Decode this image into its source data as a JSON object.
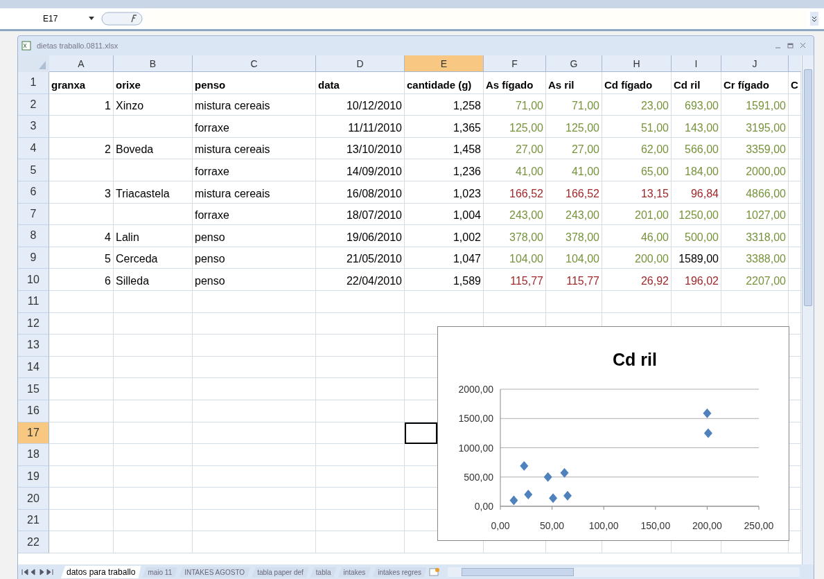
{
  "name_box": "E17",
  "workbook": {
    "title": "dietas traballo.0811.xlsx"
  },
  "columns": [
    {
      "letter": "A",
      "selected": false
    },
    {
      "letter": "B",
      "selected": false
    },
    {
      "letter": "C",
      "selected": false
    },
    {
      "letter": "D",
      "selected": false
    },
    {
      "letter": "E",
      "selected": true
    },
    {
      "letter": "F",
      "selected": false
    },
    {
      "letter": "G",
      "selected": false
    },
    {
      "letter": "H",
      "selected": false
    },
    {
      "letter": "I",
      "selected": false
    },
    {
      "letter": "J",
      "selected": false
    }
  ],
  "rows": [
    {
      "num": "1",
      "selected": false,
      "kind": "header",
      "cells": [
        {
          "text": "granxa"
        },
        {
          "text": "orixe"
        },
        {
          "text": "penso"
        },
        {
          "text": "data"
        },
        {
          "text": "cantidade (g)"
        },
        {
          "text": "As fígado"
        },
        {
          "text": "As ril"
        },
        {
          "text": "Cd fígado"
        },
        {
          "text": "Cd ril"
        },
        {
          "text": "Cr fígado"
        },
        {
          "text": "C"
        }
      ]
    },
    {
      "num": "2",
      "selected": false,
      "kind": "data",
      "cells": [
        {
          "text": "1"
        },
        {
          "text": "Xinzo"
        },
        {
          "text": "mistura cereais"
        },
        {
          "text": "10/12/2010"
        },
        {
          "text": "1,258"
        },
        {
          "text": "71,00",
          "color": "#77933c"
        },
        {
          "text": "71,00",
          "color": "#77933c"
        },
        {
          "text": "23,00",
          "color": "#77933c"
        },
        {
          "text": "693,00",
          "color": "#77933c"
        },
        {
          "text": "1591,00",
          "color": "#77933c"
        },
        null
      ]
    },
    {
      "num": "3",
      "selected": false,
      "kind": "data",
      "cells": [
        null,
        null,
        {
          "text": "forraxe"
        },
        {
          "text": "11/11/2010"
        },
        {
          "text": "1,365"
        },
        {
          "text": "125,00",
          "color": "#77933c"
        },
        {
          "text": "125,00",
          "color": "#77933c"
        },
        {
          "text": "51,00",
          "color": "#77933c"
        },
        {
          "text": "143,00",
          "color": "#77933c"
        },
        {
          "text": "3195,00",
          "color": "#77933c"
        },
        null
      ]
    },
    {
      "num": "4",
      "selected": false,
      "kind": "data",
      "cells": [
        {
          "text": "2"
        },
        {
          "text": "Boveda"
        },
        {
          "text": "mistura cereais"
        },
        {
          "text": "13/10/2010"
        },
        {
          "text": "1,458"
        },
        {
          "text": "27,00",
          "color": "#77933c"
        },
        {
          "text": "27,00",
          "color": "#77933c"
        },
        {
          "text": "62,00",
          "color": "#77933c"
        },
        {
          "text": "566,00",
          "color": "#77933c"
        },
        {
          "text": "3359,00",
          "color": "#77933c"
        },
        null
      ]
    },
    {
      "num": "5",
      "selected": false,
      "kind": "data",
      "cells": [
        null,
        null,
        {
          "text": "forraxe"
        },
        {
          "text": "14/09/2010"
        },
        {
          "text": "1,236"
        },
        {
          "text": "41,00",
          "color": "#77933c"
        },
        {
          "text": "41,00",
          "color": "#77933c"
        },
        {
          "text": "65,00",
          "color": "#77933c"
        },
        {
          "text": "184,00",
          "color": "#77933c"
        },
        {
          "text": "2000,00",
          "color": "#77933c"
        },
        null
      ]
    },
    {
      "num": "6",
      "selected": false,
      "kind": "data",
      "cells": [
        {
          "text": "3"
        },
        {
          "text": "Triacastela"
        },
        {
          "text": "mistura cereais"
        },
        {
          "text": "16/08/2010"
        },
        {
          "text": "1,023"
        },
        {
          "text": "166,52",
          "color": "#a0282a"
        },
        {
          "text": "166,52",
          "color": "#a0282a"
        },
        {
          "text": "13,15",
          "color": "#a0282a"
        },
        {
          "text": "96,84",
          "color": "#a0282a"
        },
        {
          "text": "4866,00",
          "color": "#77933c"
        },
        null
      ]
    },
    {
      "num": "7",
      "selected": false,
      "kind": "data",
      "cells": [
        null,
        null,
        {
          "text": "forraxe"
        },
        {
          "text": "18/07/2010"
        },
        {
          "text": "1,004"
        },
        {
          "text": "243,00",
          "color": "#77933c"
        },
        {
          "text": "243,00",
          "color": "#77933c"
        },
        {
          "text": "201,00",
          "color": "#77933c"
        },
        {
          "text": "1250,00",
          "color": "#77933c"
        },
        {
          "text": "1027,00",
          "color": "#77933c"
        },
        null
      ]
    },
    {
      "num": "8",
      "selected": false,
      "kind": "data",
      "cells": [
        {
          "text": "4"
        },
        {
          "text": "Lalin"
        },
        {
          "text": "penso"
        },
        {
          "text": "19/06/2010"
        },
        {
          "text": "1,002"
        },
        {
          "text": "378,00",
          "color": "#77933c"
        },
        {
          "text": "378,00",
          "color": "#77933c"
        },
        {
          "text": "46,00",
          "color": "#77933c"
        },
        {
          "text": "500,00",
          "color": "#77933c"
        },
        {
          "text": "3318,00",
          "color": "#77933c"
        },
        null
      ]
    },
    {
      "num": "9",
      "selected": false,
      "kind": "data",
      "cells": [
        {
          "text": "5"
        },
        {
          "text": "Cerceda"
        },
        {
          "text": "penso"
        },
        {
          "text": "21/05/2010"
        },
        {
          "text": "1,047"
        },
        {
          "text": "104,00",
          "color": "#77933c"
        },
        {
          "text": "104,00",
          "color": "#77933c"
        },
        {
          "text": "200,00",
          "color": "#77933c"
        },
        {
          "text": "1589,00",
          "color": "#000000"
        },
        {
          "text": "3388,00",
          "color": "#77933c"
        },
        null
      ]
    },
    {
      "num": "10",
      "selected": false,
      "kind": "data",
      "cells": [
        {
          "text": "6"
        },
        {
          "text": "Silleda"
        },
        {
          "text": "penso"
        },
        {
          "text": "22/04/2010"
        },
        {
          "text": "1,589"
        },
        {
          "text": "115,77",
          "color": "#a0282a"
        },
        {
          "text": "115,77",
          "color": "#a0282a"
        },
        {
          "text": "26,92",
          "color": "#a0282a"
        },
        {
          "text": "196,02",
          "color": "#a0282a"
        },
        {
          "text": "2207,00",
          "color": "#77933c"
        },
        null
      ]
    },
    {
      "num": "11",
      "selected": false,
      "kind": "data"
    },
    {
      "num": "12",
      "selected": false,
      "kind": "data"
    },
    {
      "num": "13",
      "selected": false,
      "kind": "data"
    },
    {
      "num": "14",
      "selected": false,
      "kind": "data"
    },
    {
      "num": "15",
      "selected": false,
      "kind": "data"
    },
    {
      "num": "16",
      "selected": false,
      "kind": "data"
    },
    {
      "num": "17",
      "selected": true,
      "kind": "data"
    },
    {
      "num": "18",
      "selected": false,
      "kind": "data"
    },
    {
      "num": "19",
      "selected": false,
      "kind": "data"
    },
    {
      "num": "20",
      "selected": false,
      "kind": "data"
    },
    {
      "num": "21",
      "selected": false,
      "kind": "data"
    },
    {
      "num": "22",
      "selected": false,
      "kind": "data"
    }
  ],
  "chart": {
    "chart_data": {
      "type": "scatter",
      "title": "Cd ril",
      "grid": true,
      "series": [
        {
          "color": "#4f81bd",
          "x": [
            23,
            51,
            62,
            65,
            13,
            201,
            46,
            200,
            27
          ],
          "values": [
            690,
            140,
            570,
            180,
            100,
            1250,
            500,
            1590,
            200
          ]
        }
      ],
      "xlim": [
        0,
        250
      ],
      "ylim": [
        0,
        2000
      ],
      "xticks": [
        {
          "value": 0,
          "label": "0,00"
        },
        {
          "value": 50,
          "label": "50,00"
        },
        {
          "value": 100,
          "label": "100,00"
        },
        {
          "value": 150,
          "label": "150,00"
        },
        {
          "value": 200,
          "label": "200,00"
        },
        {
          "value": 250,
          "label": "250,00"
        }
      ],
      "yticks": [
        {
          "value": 0,
          "label": "0,00"
        },
        {
          "value": 500,
          "label": "500,00"
        },
        {
          "value": 1000,
          "label": "1000,00"
        },
        {
          "value": 1500,
          "label": "1500,00"
        },
        {
          "value": 2000,
          "label": "2000,00"
        }
      ]
    }
  },
  "sheet_tabs": [
    {
      "label": "datos para traballo",
      "selected": true
    },
    {
      "label": "maio 11",
      "selected": false
    },
    {
      "label": "INTAKES AGOSTO",
      "selected": false
    },
    {
      "label": "tabla paper def",
      "selected": false
    },
    {
      "label": "tabla",
      "selected": false
    },
    {
      "label": "intakes",
      "selected": false
    },
    {
      "label": "intakes regres",
      "selected": false
    }
  ]
}
